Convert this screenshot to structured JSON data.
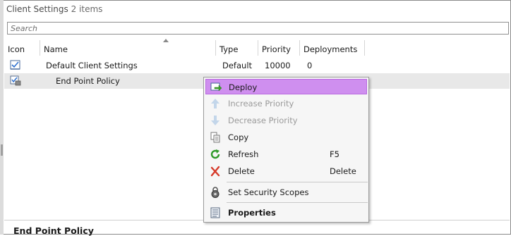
{
  "panel": {
    "title": "Client Settings",
    "count": "2 items"
  },
  "search": {
    "placeholder": "Search"
  },
  "columns": {
    "icon": "Icon",
    "name": "Name",
    "type": "Type",
    "priority": "Priority",
    "deployments": "Deployments"
  },
  "rows": [
    {
      "name": "Default Client Settings",
      "type": "Default",
      "priority": "10000",
      "deployments": "0",
      "icon": "client-settings-icon"
    },
    {
      "name": "End Point Policy",
      "type": "",
      "priority": "",
      "deployments": "",
      "icon": "antimalware-policy-icon"
    }
  ],
  "details": {
    "title": "End Point Policy"
  },
  "context_menu": {
    "items": [
      {
        "label": "Deploy",
        "shortcut": "",
        "icon": "deploy-icon",
        "enabled": true,
        "highlighted": true
      },
      {
        "label": "Increase Priority",
        "shortcut": "",
        "icon": "arrow-up-icon",
        "enabled": false
      },
      {
        "label": "Decrease Priority",
        "shortcut": "",
        "icon": "arrow-down-icon",
        "enabled": false
      },
      {
        "label": "Copy",
        "shortcut": "",
        "icon": "copy-icon",
        "enabled": true
      },
      {
        "label": "Refresh",
        "shortcut": "F5",
        "icon": "refresh-icon",
        "enabled": true
      },
      {
        "label": "Delete",
        "shortcut": "Delete",
        "icon": "delete-icon",
        "enabled": true
      },
      {
        "label": "Set Security Scopes",
        "shortcut": "",
        "icon": "security-scopes-icon",
        "enabled": true
      },
      {
        "label": "Properties",
        "shortcut": "",
        "icon": "properties-icon",
        "enabled": true,
        "bold": true
      }
    ]
  },
  "colors": {
    "highlight": "#cf8fef",
    "highlight_border": "#b868e0",
    "disabled_text": "#9a9a9a",
    "selected_row": "#e8e8e8"
  }
}
